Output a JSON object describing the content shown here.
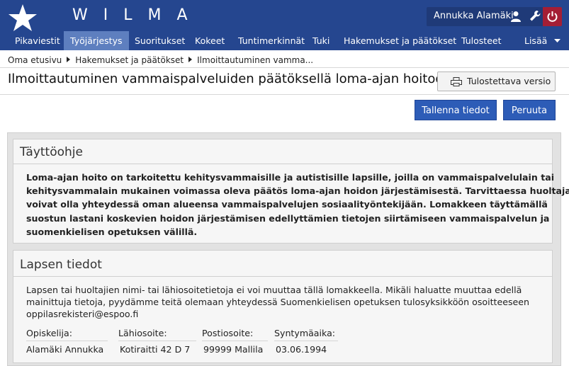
{
  "app": {
    "brand": "WILMA"
  },
  "user": {
    "name": "Annukka Alamäki"
  },
  "nav": {
    "items": [
      {
        "label": "Pikaviestit"
      },
      {
        "label": "Työjärjestys"
      },
      {
        "label": "Suoritukset"
      },
      {
        "label": "Kokeet"
      },
      {
        "label": "Tuntimerkinnät"
      },
      {
        "label": "Tuki"
      },
      {
        "label": "Hakemukset ja päätökset"
      },
      {
        "label": "Tulosteet"
      },
      {
        "label": "Lisää"
      }
    ],
    "active": "Työjärjestys"
  },
  "breadcrumb": [
    "Oma etusivu",
    "Hakemukset ja päätökset",
    "Ilmoittautuminen vamma..."
  ],
  "page": {
    "title": "Ilmoittautuminen vammaispalveluiden päätöksellä loma-ajan hoitoon"
  },
  "toolbar": {
    "print_label": "Tulostettava versio",
    "save_label": "Tallenna tiedot",
    "cancel_label": "Peruuta"
  },
  "instructions": {
    "title": "Täyttöohje",
    "lines": [
      "Loma-ajan hoito on tarkoitettu kehitysvammaisille ja autistisille lapsille, joilla on vammaispalvelulain tai",
      "kehitysvammalain mukainen voimassa oleva päätös loma-ajan hoidon järjestämisestä. Tarvittaessa huoltajat",
      "voivat olla yhteydessä oman alueensa vammaispalvelujen sosiaalityöntekijään. Lomakkeen täyttämällä",
      "suostun lastani koskevien hoidon järjestämisen edellyttämien tietojen siirtämiseen vammaispalvelun ja",
      "suomenkielisen opetuksen välillä."
    ]
  },
  "child": {
    "title": "Lapsen tiedot",
    "info_lines": [
      "Lapsen tai huoltajien nimi- tai lähiosoitetietoja ei voi muuttaa tällä lomakkeella. Mikäli haluatte muuttaa edellä",
      "mainittuja tietoja, pyydämme teitä olemaan yhteydessä Suomenkielisen opetuksen tulosyksikköön osoitteeseen",
      "oppilasrekisteri@espoo.fi"
    ],
    "fields": [
      {
        "label": "Opiskelija:",
        "value": "Alamäki Annukka"
      },
      {
        "label": "Lähiosoite:",
        "value": "Kotiraitti 42 D 7"
      },
      {
        "label": "Postiosoite:",
        "value": "99999 Mallila"
      },
      {
        "label": "Syntymäaika:",
        "value": "03.06.1994"
      }
    ]
  }
}
